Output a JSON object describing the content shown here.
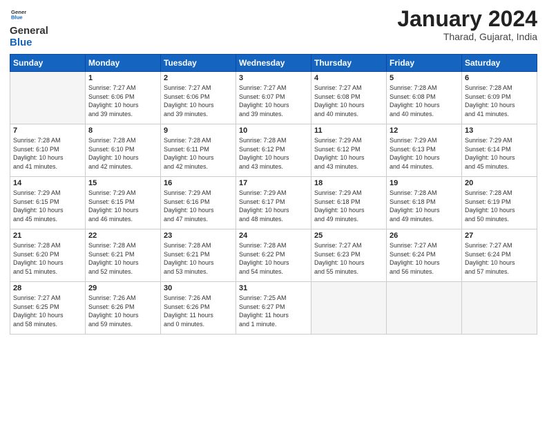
{
  "logo": {
    "line1": "General",
    "line2": "Blue"
  },
  "title": "January 2024",
  "subtitle": "Tharad, Gujarat, India",
  "days_header": [
    "Sunday",
    "Monday",
    "Tuesday",
    "Wednesday",
    "Thursday",
    "Friday",
    "Saturday"
  ],
  "weeks": [
    [
      {
        "num": "",
        "info": ""
      },
      {
        "num": "1",
        "info": "Sunrise: 7:27 AM\nSunset: 6:06 PM\nDaylight: 10 hours\nand 39 minutes."
      },
      {
        "num": "2",
        "info": "Sunrise: 7:27 AM\nSunset: 6:06 PM\nDaylight: 10 hours\nand 39 minutes."
      },
      {
        "num": "3",
        "info": "Sunrise: 7:27 AM\nSunset: 6:07 PM\nDaylight: 10 hours\nand 39 minutes."
      },
      {
        "num": "4",
        "info": "Sunrise: 7:27 AM\nSunset: 6:08 PM\nDaylight: 10 hours\nand 40 minutes."
      },
      {
        "num": "5",
        "info": "Sunrise: 7:28 AM\nSunset: 6:08 PM\nDaylight: 10 hours\nand 40 minutes."
      },
      {
        "num": "6",
        "info": "Sunrise: 7:28 AM\nSunset: 6:09 PM\nDaylight: 10 hours\nand 41 minutes."
      }
    ],
    [
      {
        "num": "7",
        "info": "Sunrise: 7:28 AM\nSunset: 6:10 PM\nDaylight: 10 hours\nand 41 minutes."
      },
      {
        "num": "8",
        "info": "Sunrise: 7:28 AM\nSunset: 6:10 PM\nDaylight: 10 hours\nand 42 minutes."
      },
      {
        "num": "9",
        "info": "Sunrise: 7:28 AM\nSunset: 6:11 PM\nDaylight: 10 hours\nand 42 minutes."
      },
      {
        "num": "10",
        "info": "Sunrise: 7:28 AM\nSunset: 6:12 PM\nDaylight: 10 hours\nand 43 minutes."
      },
      {
        "num": "11",
        "info": "Sunrise: 7:29 AM\nSunset: 6:12 PM\nDaylight: 10 hours\nand 43 minutes."
      },
      {
        "num": "12",
        "info": "Sunrise: 7:29 AM\nSunset: 6:13 PM\nDaylight: 10 hours\nand 44 minutes."
      },
      {
        "num": "13",
        "info": "Sunrise: 7:29 AM\nSunset: 6:14 PM\nDaylight: 10 hours\nand 45 minutes."
      }
    ],
    [
      {
        "num": "14",
        "info": "Sunrise: 7:29 AM\nSunset: 6:15 PM\nDaylight: 10 hours\nand 45 minutes."
      },
      {
        "num": "15",
        "info": "Sunrise: 7:29 AM\nSunset: 6:15 PM\nDaylight: 10 hours\nand 46 minutes."
      },
      {
        "num": "16",
        "info": "Sunrise: 7:29 AM\nSunset: 6:16 PM\nDaylight: 10 hours\nand 47 minutes."
      },
      {
        "num": "17",
        "info": "Sunrise: 7:29 AM\nSunset: 6:17 PM\nDaylight: 10 hours\nand 48 minutes."
      },
      {
        "num": "18",
        "info": "Sunrise: 7:29 AM\nSunset: 6:18 PM\nDaylight: 10 hours\nand 49 minutes."
      },
      {
        "num": "19",
        "info": "Sunrise: 7:28 AM\nSunset: 6:18 PM\nDaylight: 10 hours\nand 49 minutes."
      },
      {
        "num": "20",
        "info": "Sunrise: 7:28 AM\nSunset: 6:19 PM\nDaylight: 10 hours\nand 50 minutes."
      }
    ],
    [
      {
        "num": "21",
        "info": "Sunrise: 7:28 AM\nSunset: 6:20 PM\nDaylight: 10 hours\nand 51 minutes."
      },
      {
        "num": "22",
        "info": "Sunrise: 7:28 AM\nSunset: 6:21 PM\nDaylight: 10 hours\nand 52 minutes."
      },
      {
        "num": "23",
        "info": "Sunrise: 7:28 AM\nSunset: 6:21 PM\nDaylight: 10 hours\nand 53 minutes."
      },
      {
        "num": "24",
        "info": "Sunrise: 7:28 AM\nSunset: 6:22 PM\nDaylight: 10 hours\nand 54 minutes."
      },
      {
        "num": "25",
        "info": "Sunrise: 7:27 AM\nSunset: 6:23 PM\nDaylight: 10 hours\nand 55 minutes."
      },
      {
        "num": "26",
        "info": "Sunrise: 7:27 AM\nSunset: 6:24 PM\nDaylight: 10 hours\nand 56 minutes."
      },
      {
        "num": "27",
        "info": "Sunrise: 7:27 AM\nSunset: 6:24 PM\nDaylight: 10 hours\nand 57 minutes."
      }
    ],
    [
      {
        "num": "28",
        "info": "Sunrise: 7:27 AM\nSunset: 6:25 PM\nDaylight: 10 hours\nand 58 minutes."
      },
      {
        "num": "29",
        "info": "Sunrise: 7:26 AM\nSunset: 6:26 PM\nDaylight: 10 hours\nand 59 minutes."
      },
      {
        "num": "30",
        "info": "Sunrise: 7:26 AM\nSunset: 6:26 PM\nDaylight: 11 hours\nand 0 minutes."
      },
      {
        "num": "31",
        "info": "Sunrise: 7:25 AM\nSunset: 6:27 PM\nDaylight: 11 hours\nand 1 minute."
      },
      {
        "num": "",
        "info": ""
      },
      {
        "num": "",
        "info": ""
      },
      {
        "num": "",
        "info": ""
      }
    ]
  ]
}
